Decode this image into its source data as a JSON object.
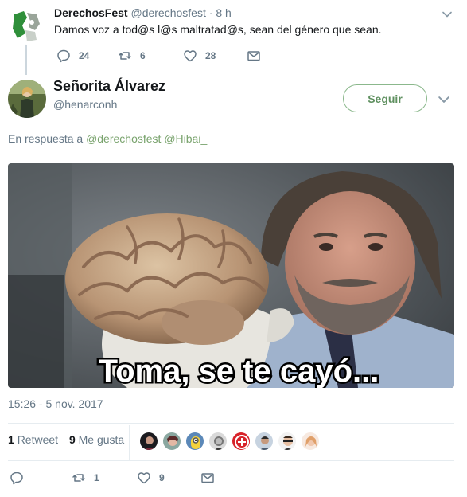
{
  "parent_tweet": {
    "display_name": "DerechosFest",
    "handle": "@derechosfest",
    "separator": "·",
    "time": "8 h",
    "text": "Damos voz a tod@s l@s maltratad@s, sean del género que sean.",
    "replies": "24",
    "retweets": "6",
    "likes": "28"
  },
  "tweet": {
    "display_name": "Señorita Álvarez",
    "handle": "@henarconh",
    "follow_label": "Seguir",
    "reply_prefix": "En respuesta a",
    "reply_mention_1": "@derechosfest",
    "reply_mention_2": "@Hibai_",
    "image_caption": "Toma, se te cayó...",
    "timestamp": "15:26 - 5 nov. 2017",
    "retweet_count": "1",
    "retweet_label": "Retweet",
    "like_count": "9",
    "like_label": "Me gusta",
    "reply_count": "",
    "action_retweets": "1",
    "action_likes": "9"
  },
  "colors": {
    "accent_green": "#79a36d",
    "muted_text": "#657786",
    "divider": "#e6ecf0"
  },
  "icons": [
    "reply-icon",
    "retweet-icon",
    "heart-icon",
    "mail-icon",
    "chevron-down-icon"
  ]
}
